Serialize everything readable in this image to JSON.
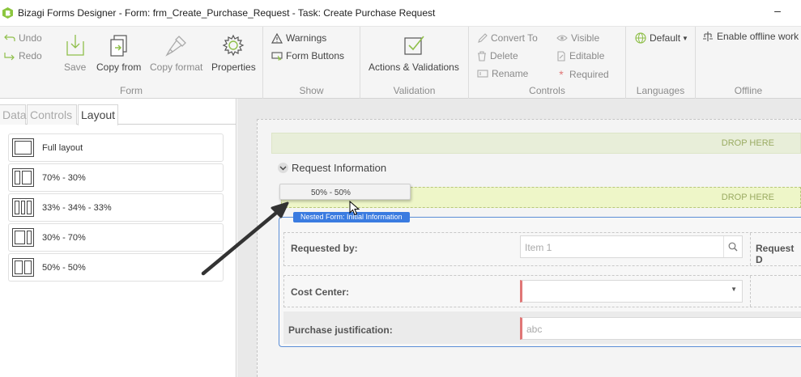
{
  "window": {
    "title": "Bizagi Forms Designer  - Form: frm_Create_Purchase_Request - Task:  Create Purchase Request",
    "minimize_glyph": "–"
  },
  "ribbon": {
    "form": {
      "label": "Form",
      "undo": "Undo",
      "redo": "Redo",
      "save": "Save",
      "copy_from": "Copy from",
      "copy_format": "Copy format",
      "properties": "Properties"
    },
    "show": {
      "label": "Show",
      "warnings": "Warnings",
      "form_buttons": "Form Buttons"
    },
    "validation": {
      "label": "Validation",
      "actions": "Actions & Validations"
    },
    "controls": {
      "label": "Controls",
      "convert_to": "Convert To",
      "delete": "Delete",
      "rename": "Rename",
      "visible": "Visible",
      "editable": "Editable",
      "required": "Required"
    },
    "languages": {
      "label": "Languages",
      "default": "Default"
    },
    "offline": {
      "label": "Offline",
      "enable": "Enable offline work"
    }
  },
  "left_panel": {
    "tabs": [
      "Data",
      "Controls",
      "Layout"
    ],
    "active_tab": "Layout",
    "layouts": [
      {
        "label": "Full layout",
        "cols": [
          1
        ]
      },
      {
        "label": "70% - 30%",
        "cols": [
          7,
          3
        ]
      },
      {
        "label": "33% - 34% - 33%",
        "cols": [
          1,
          1,
          1
        ]
      },
      {
        "label": "30% - 70%",
        "cols": [
          3,
          7
        ]
      },
      {
        "label": "50% - 50%",
        "cols": [
          1,
          1
        ]
      }
    ]
  },
  "canvas": {
    "drop_here_1": "DROP HERE",
    "section_title": "Request Information",
    "drag_ghost": "50% - 50%",
    "drop_here_2": "DROP HERE",
    "nested_form_tag": "Nested Form: Initial Information",
    "fields": {
      "requested_by_label": "Requested by:",
      "requested_by_placeholder": "Item 1",
      "request_date_label": "Request D",
      "cost_center_label": "Cost Center:",
      "purchase_justification_label": "Purchase justification:",
      "purchase_justification_placeholder": "abc"
    }
  },
  "colors": {
    "accent_blue": "#3a7be0",
    "drop_green": "#9aab62",
    "required_red": "#e07676",
    "arrow_dark": "#333333"
  }
}
